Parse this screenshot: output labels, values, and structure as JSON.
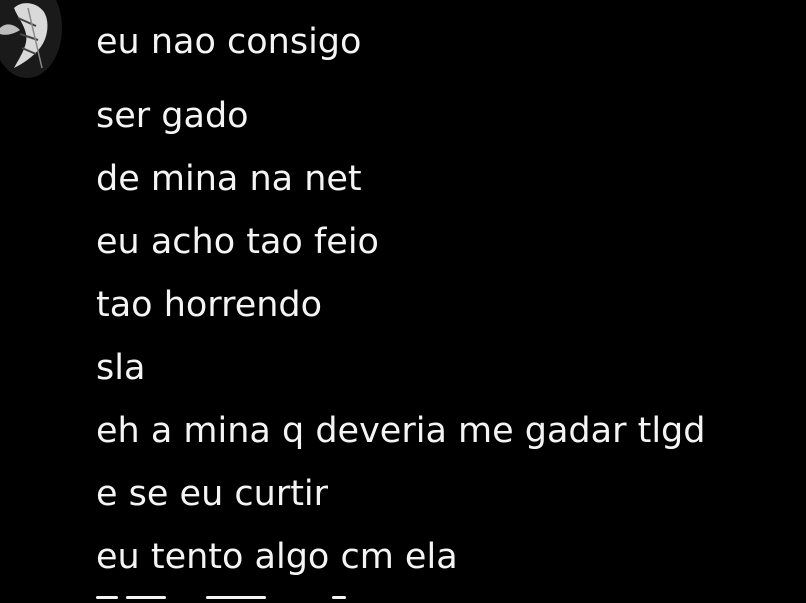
{
  "conversation": {
    "first_message": "eu nao consigo",
    "lines": [
      "ser gado",
      "de mina na net",
      "eu acho tao feio",
      "tao horrendo",
      "sla",
      "eh a mina q deveria me gadar tlgd",
      "e se eu curtir",
      "eu tento algo cm ela"
    ]
  },
  "colors": {
    "background": "#000000",
    "text": "#f4f4f4"
  },
  "icons": {
    "avatar": "profile-avatar"
  }
}
